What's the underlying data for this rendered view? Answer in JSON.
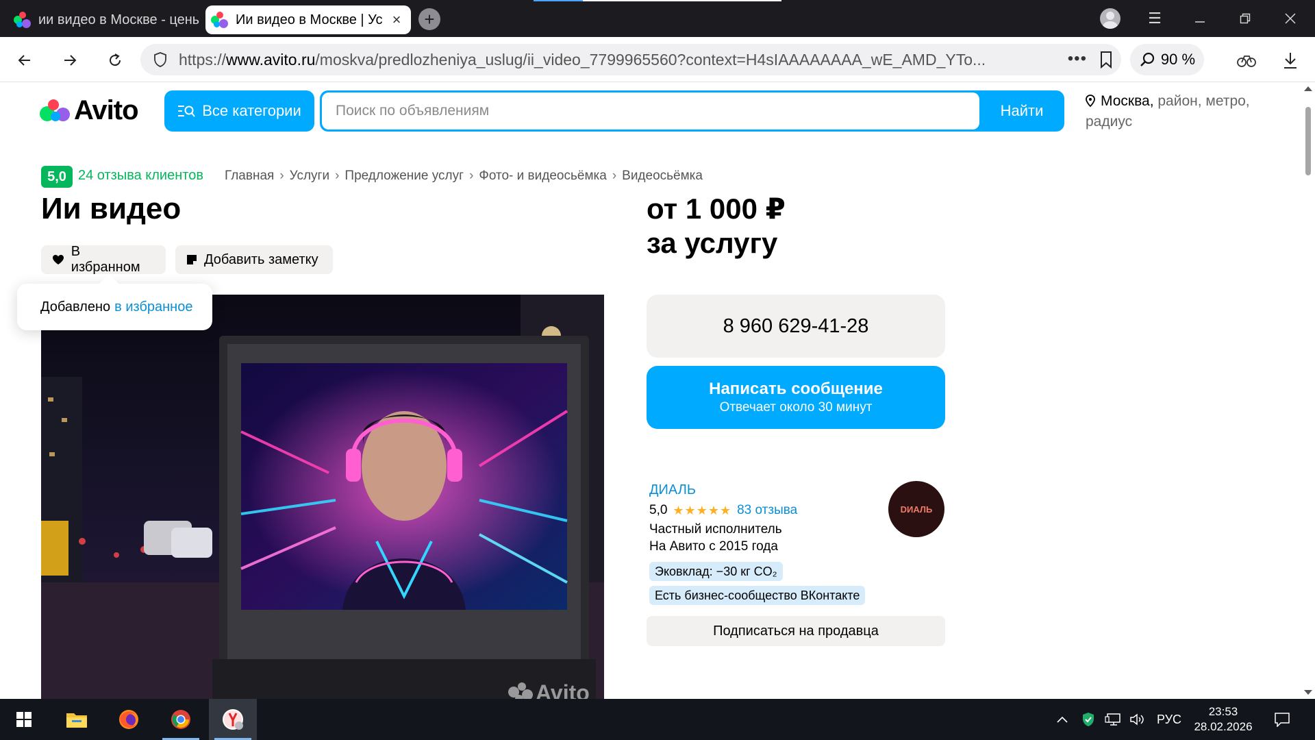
{
  "browser": {
    "tabs": [
      {
        "title": "ии видео в Москве - цены",
        "active": false
      },
      {
        "title": "Ии видео в Москве | Ус",
        "active": true
      }
    ],
    "url_prefix": "https://",
    "url_domain": "www.avito.ru",
    "url_path": "/moskva/predlozheniya_uslug/ii_video_7799965560?context=H4sIAAAAAAAA_wE_AMD_YTo...",
    "zoom": "90 %"
  },
  "site": {
    "logo_text": "Avito",
    "all_categories_label": "Все категории",
    "search_placeholder": "Поиск по объявлениям",
    "search_button": "Найти",
    "location_city": "Москва",
    "location_rest": "район, метро, радиус",
    "colors": {
      "accent": "#00aaff",
      "green": "#04b65c",
      "link": "#0a8fd6"
    }
  },
  "listing": {
    "rating": "5,0",
    "reviews_link": "24 отзыва клиентов",
    "breadcrumbs": [
      "Главная",
      "Услуги",
      "Предложение услуг",
      "Фото- и видеосьёмка",
      "Видеосьёмка"
    ],
    "title": "Ии видео",
    "price_line1": "от 1 000 ₽",
    "price_line2": "за услугу",
    "favorite_label": "В избранном",
    "note_label": "Добавить заметку",
    "toast_text": "Добавлено",
    "toast_link": "в избранное",
    "photo_watermark": "Avito",
    "phone": "8 960 629-41-28",
    "message_button": "Написать сообщение",
    "message_sub": "Отвечает около 30 минут"
  },
  "seller": {
    "name": "ДИАЛЬ",
    "rating": "5,0",
    "stars": "★★★★★",
    "reviews": "83 отзыва",
    "type": "Частный исполнитель",
    "since": "На Авито с 2015 года",
    "tags": [
      "Эковклад: −30 кг CO₂",
      "Есть бизнес-сообщество ВКонтакте"
    ],
    "avatar_text": "DИАЛЬ",
    "subscribe_label": "Подписаться на продавца"
  },
  "taskbar": {
    "language": "РУС",
    "time": "23:53",
    "date": "28.02.2026"
  }
}
